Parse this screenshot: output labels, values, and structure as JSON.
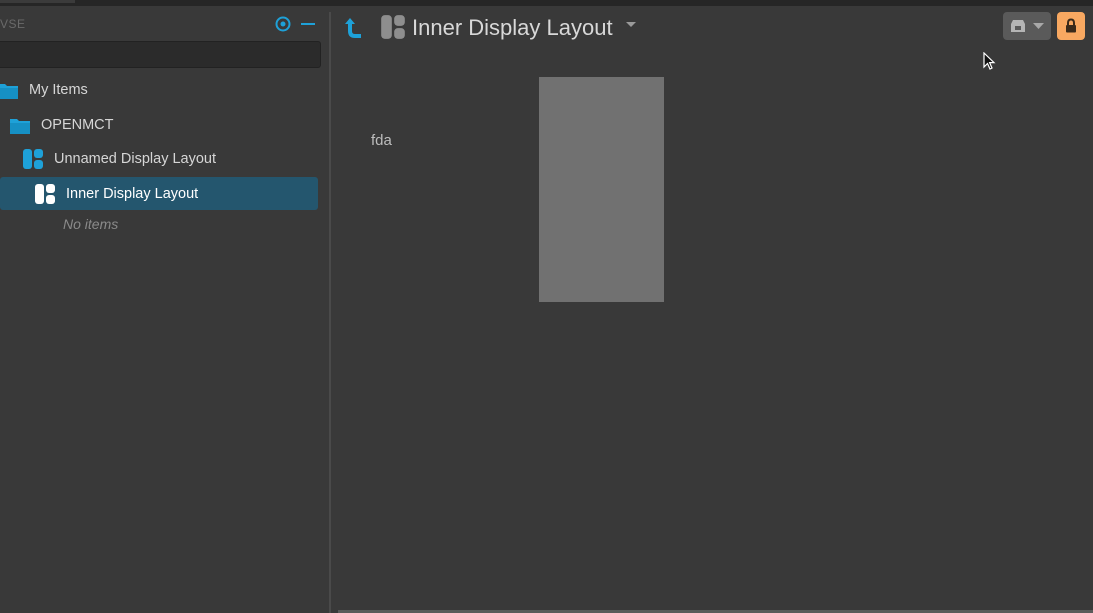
{
  "browse": {
    "title": "VSE",
    "search": {
      "value": "",
      "placeholder": ""
    }
  },
  "tree": {
    "items": [
      {
        "label": "My Items",
        "icon": "folder-icon"
      },
      {
        "label": "OPENMCT",
        "icon": "folder-icon"
      },
      {
        "label": "Unnamed Display Layout",
        "icon": "display-layout-icon"
      },
      {
        "label": "Inner Display Layout",
        "icon": "display-layout-icon",
        "selected": true
      }
    ],
    "empty_text": "No items"
  },
  "object": {
    "title": "Inner Display Layout",
    "icon": "display-layout-icon"
  },
  "toolbar": {
    "view_switcher_icon": "view-switcher-icon",
    "lock_icon": "lock-icon"
  },
  "layout": {
    "text_element": "fda",
    "box_color": "#717171"
  },
  "colors": {
    "accent": "#1ea1d8",
    "selection": "#24566e",
    "lock": "#f8a861",
    "background": "#393939"
  }
}
